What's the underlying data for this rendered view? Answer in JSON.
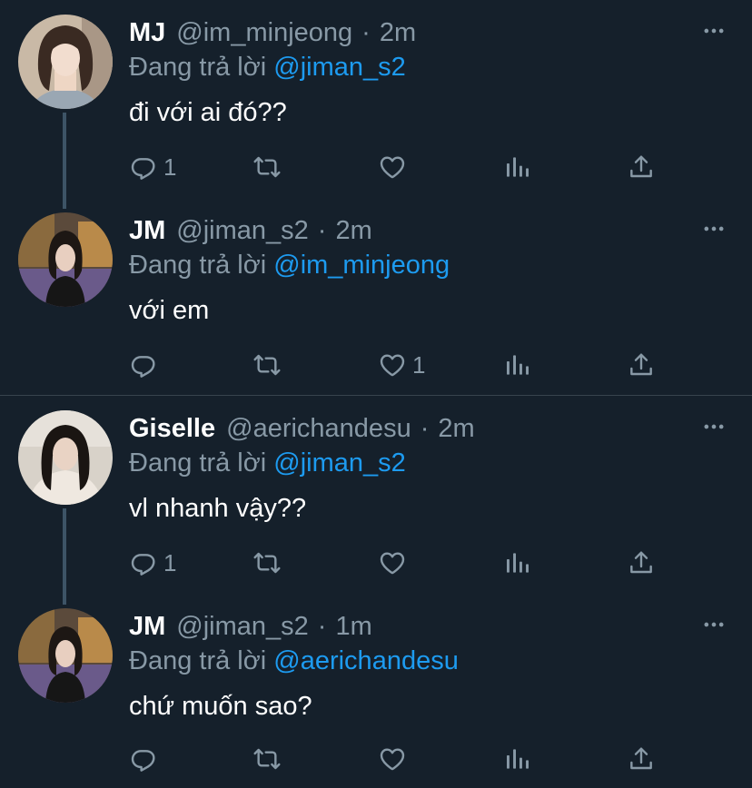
{
  "colors": {
    "background": "#15202b",
    "secondary_text": "#8899a6",
    "mention": "#1d9bf0",
    "divider": "#38444d"
  },
  "replying_prefix": "Đang trả lời",
  "tweets": [
    {
      "name": "MJ",
      "handle": "@im_minjeong",
      "time": "2m",
      "replying_to": "@jiman_s2",
      "text": "đi với ai đó??",
      "reply_count": "1",
      "retweet_count": "",
      "like_count": "",
      "avatar": "avatar-mj"
    },
    {
      "name": "JM",
      "handle": "@jiman_s2",
      "time": "2m",
      "replying_to": "@im_minjeong",
      "text": "với em",
      "reply_count": "",
      "retweet_count": "",
      "like_count": "1",
      "avatar": "avatar-jm"
    },
    {
      "name": "Giselle",
      "handle": "@aerichandesu",
      "time": "2m",
      "replying_to": "@jiman_s2",
      "text": "vl nhanh vậy??",
      "reply_count": "1",
      "retweet_count": "",
      "like_count": "",
      "avatar": "avatar-giselle"
    },
    {
      "name": "JM",
      "handle": "@jiman_s2",
      "time": "1m",
      "replying_to": "@aerichandesu",
      "text": "chứ muốn sao?",
      "reply_count": "",
      "retweet_count": "",
      "like_count": "",
      "avatar": "avatar-jm"
    }
  ]
}
